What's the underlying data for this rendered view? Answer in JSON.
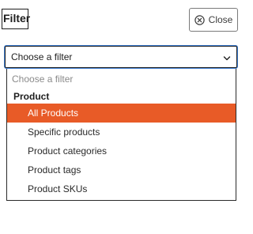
{
  "header": {
    "title": "Filter",
    "close_label": "Close",
    "close_icon": "circle-x-icon"
  },
  "select": {
    "value": "Choose a filter",
    "chevron_icon": "chevron-down-icon"
  },
  "dropdown": {
    "placeholder": "Choose a filter",
    "group_label": "Product",
    "options": [
      {
        "label": "All Products",
        "selected": true
      },
      {
        "label": "Specific products",
        "selected": false
      },
      {
        "label": "Product categories",
        "selected": false
      },
      {
        "label": "Product tags",
        "selected": false
      },
      {
        "label": "Product SKUs",
        "selected": false
      }
    ]
  },
  "colors": {
    "accent": "#e85b27",
    "focus": "#3f7fd4"
  }
}
